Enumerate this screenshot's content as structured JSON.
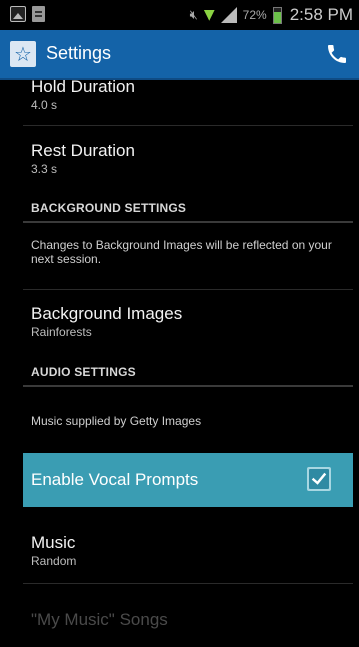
{
  "status_bar": {
    "battery_percent": "72%",
    "battery_level": 0.72,
    "time": "2:58 PM"
  },
  "action_bar": {
    "title": "Settings"
  },
  "items": {
    "hold_duration": {
      "title": "Hold Duration",
      "value": "4.0 s"
    },
    "rest_duration": {
      "title": "Rest Duration",
      "value": "3.3 s"
    },
    "background_header": "BACKGROUND SETTINGS",
    "background_info": "Changes to Background Images will be reflected on your next session.",
    "background_images": {
      "title": "Background Images",
      "value": "Rainforests"
    },
    "audio_header": "AUDIO SETTINGS",
    "audio_info": "Music supplied by Getty Images",
    "vocal_prompts": {
      "title": "Enable Vocal Prompts",
      "checked": true
    },
    "music": {
      "title": "Music",
      "value": "Random"
    },
    "my_music": {
      "title": "\"My Music\" Songs"
    }
  },
  "colors": {
    "action_bar": "#1463a8",
    "highlight": "#3a9db3",
    "background": "#000000"
  }
}
